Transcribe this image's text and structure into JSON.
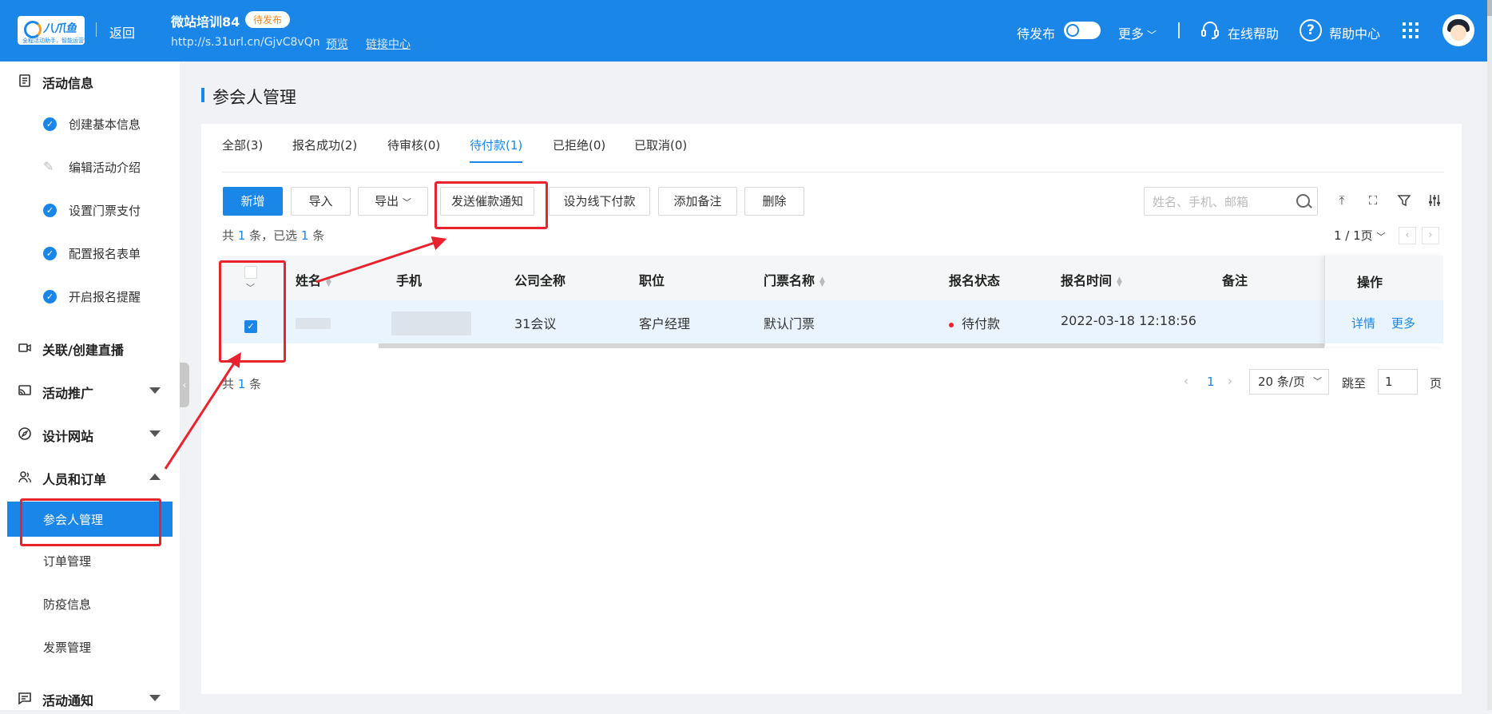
{
  "topbar": {
    "logo_text": "八爪鱼",
    "logo_sub": "全程活动助手，智能运营管家",
    "back": "返回",
    "title": "微站培训84",
    "status_badge": "待发布",
    "url": "http://s.31url.cn/GjvC8vQn",
    "preview": "预览",
    "link_center": "链接中心",
    "publish_label": "待发布",
    "more": "更多",
    "online_help": "在线帮助",
    "help_center": "帮助中心"
  },
  "sidebar": {
    "groups": {
      "activity_info": "活动信息",
      "live": "关联/创建直播",
      "promote": "活动推广",
      "design": "设计网站",
      "people": "人员和订单",
      "notify": "活动通知"
    },
    "activity_items": [
      "创建基本信息",
      "编辑活动介绍",
      "设置门票支付",
      "配置报名表单",
      "开启报名提醒"
    ],
    "people_items": [
      "参会人管理",
      "订单管理",
      "防疫信息",
      "发票管理"
    ]
  },
  "main": {
    "page_title": "参会人管理",
    "tabs": [
      "全部(3)",
      "报名成功(2)",
      "待审核(0)",
      "待付款(1)",
      "已拒绝(0)",
      "已取消(0)"
    ],
    "active_tab": "待付款(1)",
    "buttons": {
      "add": "新增",
      "import": "导入",
      "export": "导出",
      "send_reminder": "发送催款通知",
      "offline_pay": "设为线下付款",
      "add_note": "添加备注",
      "delete": "删除"
    },
    "search_placeholder": "姓名、手机、邮箱",
    "count_info": {
      "prefix": "共",
      "total": "1",
      "mid": "条，已选",
      "selected": "1",
      "suffix": "条"
    },
    "pager_top": "1 / 1页",
    "table": {
      "headers": [
        "姓名",
        "手机",
        "公司全称",
        "职位",
        "门票名称",
        "报名状态",
        "报名时间",
        "备注",
        "操作"
      ],
      "rows": [
        {
          "name": "",
          "phone": "",
          "company": "31会议",
          "position": "客户经理",
          "ticket": "默认门票",
          "status": "待付款",
          "time": "2022-03-18 12:18:56",
          "note": "",
          "actions": [
            "详情",
            "更多"
          ]
        }
      ]
    },
    "bottom": {
      "prefix": "共",
      "total": "1",
      "suffix": "条",
      "current_page": "1",
      "page_size": "20 条/页",
      "jump_label": "跳至",
      "jump_value": "1",
      "page_label": "页"
    }
  },
  "colors": {
    "primary": "#1a87e8",
    "annotation": "#e8232d",
    "status_dot": "#f5222d",
    "badge_text": "#f08a24"
  }
}
